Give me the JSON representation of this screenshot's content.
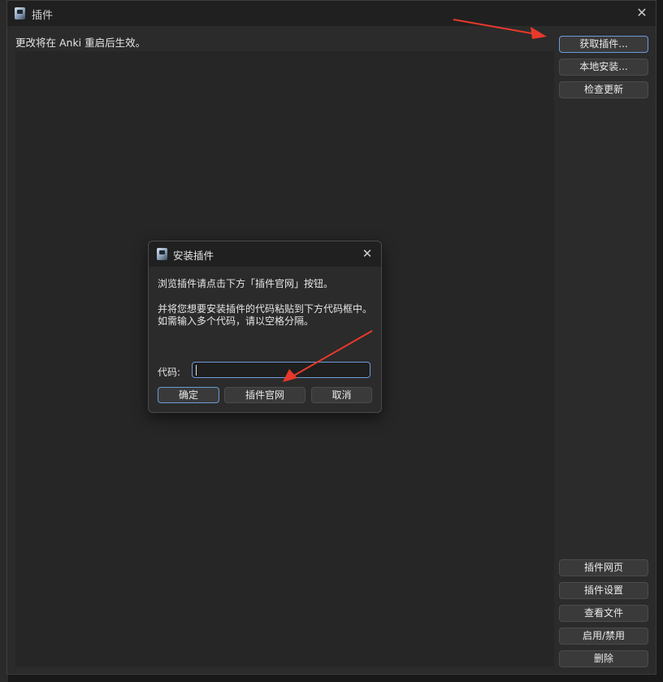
{
  "window": {
    "title": "插件",
    "close_glyph": "✕",
    "notice": "更改将在 Anki 重启后生效。"
  },
  "side_buttons_top": [
    {
      "label": "获取插件..."
    },
    {
      "label": "本地安装..."
    },
    {
      "label": "检查更新"
    }
  ],
  "side_buttons_bottom": [
    {
      "label": "插件网页"
    },
    {
      "label": "插件设置"
    },
    {
      "label": "查看文件"
    },
    {
      "label": "启用/禁用"
    },
    {
      "label": "删除"
    }
  ],
  "dialog": {
    "title": "安装插件",
    "close_glyph": "✕",
    "line1": "浏览插件请点击下方「插件官网」按钮。",
    "line2": "并将您想要安装插件的代码粘贴到下方代码框中。",
    "line3": "如需输入多个代码，请以空格分隔。",
    "code_label": "代码:",
    "code_value": "",
    "ok_label": "确定",
    "website_label": "插件官网",
    "cancel_label": "取消"
  },
  "icons": {
    "app": "anki-icon",
    "close": "close-icon"
  },
  "colors": {
    "annotation_arrow": "#e8392b",
    "focus_border": "#6e9ad6"
  }
}
